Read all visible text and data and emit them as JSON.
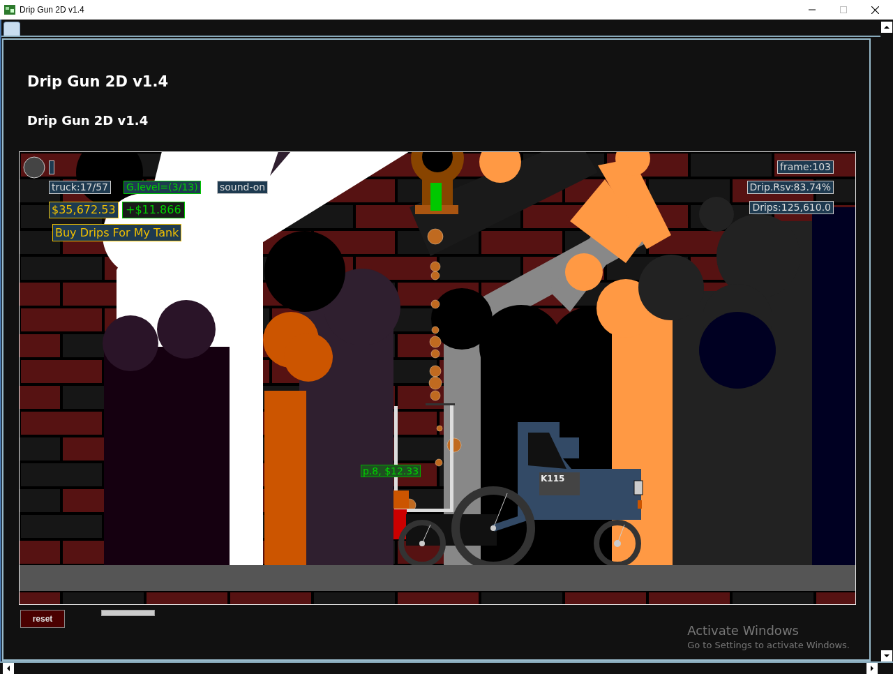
{
  "window": {
    "title": "Drip Gun 2D v1.4"
  },
  "headings": [
    "Drip Gun 2D v1.4",
    "Drip Gun 2D v1.4"
  ],
  "hud_left": [
    {
      "kind": "stat",
      "text": "truck:17/57"
    },
    {
      "kind": "level",
      "text": "G.level=(3/13)"
    },
    {
      "kind": "stat",
      "text": "sound-on"
    },
    {
      "kind": "money",
      "text": "$35,672.53"
    },
    {
      "kind": "gain",
      "text": "+$11.866"
    },
    {
      "kind": "button",
      "text": "Buy Drips For My Tank"
    }
  ],
  "hud_right": [
    {
      "kind": "stat",
      "text": "frame:103"
    },
    {
      "kind": "stat",
      "text": "Drip.Rsv:83.74%"
    },
    {
      "kind": "stat",
      "text": "Drips:125,610.0"
    }
  ],
  "price_tag": "p.8, $12.33",
  "truck_plate": "K115",
  "reset_button": "reset",
  "activation_notice": {
    "title": "Activate Windows",
    "text": "Go to Settings to activate Windows."
  }
}
